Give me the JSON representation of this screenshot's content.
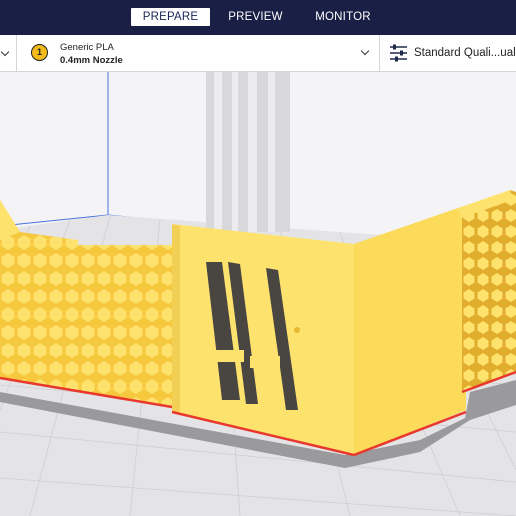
{
  "header": {
    "tabs": [
      {
        "label": "PREPARE",
        "active": true
      },
      {
        "label": "PREVIEW",
        "active": false
      },
      {
        "label": "MONITOR",
        "active": false
      }
    ]
  },
  "toolbar": {
    "extruder_number": "1",
    "material_name": "Generic PLA",
    "nozzle": "0.4mm Nozzle",
    "quality_profile": "Standard Quali...uality",
    "icons": [
      "chevron-down-icon",
      "extruder-icon",
      "chevron-down-icon",
      "settings-sliders-icon"
    ]
  },
  "colors": {
    "topbar": "#191f45",
    "model_yellow": "#fde26e",
    "model_shadow": "#ebc94c",
    "model_edge": "#e8382e",
    "build_plate": "#e4e4e6",
    "grid": "#cfcfd3",
    "axis_x": "#e8382e",
    "axis_y": "#4a72e0"
  }
}
